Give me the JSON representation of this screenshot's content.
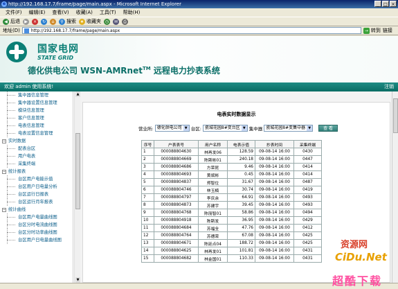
{
  "window": {
    "title": "http://192.168.17.7/frame/page/main.aspx - Microsoft Internet Explorer"
  },
  "menu": [
    "文件(F)",
    "编辑(E)",
    "查看(V)",
    "收藏(A)",
    "工具(T)",
    "帮助(H)"
  ],
  "toolbar": {
    "back": "后退",
    "search": "搜索",
    "favorites": "收藏夹"
  },
  "address": {
    "label": "地址(D)",
    "url": "http://192.168.17.7/frame/page/main.aspx",
    "go": "转到",
    "links": "链接"
  },
  "banner": {
    "brand_cn": "国家电网",
    "brand_en": "STATE GRID",
    "system_title": "德化供电公司 WSN-AMRnet",
    "tm": "TM",
    "system_suffix": " 远程电力抄表系统"
  },
  "userbar": {
    "welcome": "欢迎 admin 使用系统!",
    "logout": "注销"
  },
  "sidebar": {
    "items": [
      {
        "level": 1,
        "label": "集中器信息管理"
      },
      {
        "level": 1,
        "label": "集中器设置信息管理"
      },
      {
        "level": 1,
        "label": "模块信息管理"
      },
      {
        "level": 1,
        "label": "客户信息管理"
      },
      {
        "level": 1,
        "label": "电表信息管理"
      },
      {
        "level": 1,
        "label": "电表设置信息管理"
      },
      {
        "level": 0,
        "label": "实时数据"
      },
      {
        "level": 1,
        "label": "配表台区"
      },
      {
        "level": 1,
        "label": "用户电表"
      },
      {
        "level": 1,
        "label": "采集终端"
      },
      {
        "level": 0,
        "label": "统计报表"
      },
      {
        "level": 1,
        "label": "台区用户电能示值"
      },
      {
        "level": 1,
        "label": "台区用户日电量分析"
      },
      {
        "level": 1,
        "label": "台区运行日报表"
      },
      {
        "level": 1,
        "label": "台区运行月年报表"
      },
      {
        "level": 0,
        "label": "统计曲线"
      },
      {
        "level": 1,
        "label": "台区用户电量曲线图"
      },
      {
        "level": 1,
        "label": "台区分时电流曲线图"
      },
      {
        "level": 1,
        "label": "台区分时功率曲线图"
      },
      {
        "level": 1,
        "label": "台区用户日电量曲线图"
      }
    ]
  },
  "panel": {
    "title": "电表实时数据显示",
    "filter_label_1": "营业所:",
    "filter_value_1": "德化供电公司",
    "filter_label_2": "台区:",
    "filter_value_2": "瓷城花园8#变台区",
    "filter_label_3": "集中器",
    "filter_value_3": "瓷城花园8#变集中器",
    "query": "查 看"
  },
  "table": {
    "headers": [
      "序号",
      "户表表号",
      "用户名称",
      "电表示值",
      "抄表时间",
      "采集终端"
    ],
    "rows": [
      [
        "1",
        "000088804630",
        "林再发06",
        "128.59",
        "09-08-14 16:00",
        "0430"
      ],
      [
        "2",
        "000088804669",
        "陈斯彬01",
        "240.18",
        "09-08-14 16:00",
        "0447"
      ],
      [
        "3",
        "000088804686",
        "方荣昆",
        "9.46",
        "09-08-14 16:00",
        "0414"
      ],
      [
        "4",
        "000088804693",
        "黄斌彬",
        "0.45",
        "09-08-14 16:00",
        "0414"
      ],
      [
        "5",
        "000088804837",
        "郑智位",
        "31.67",
        "09-08-14 16:00",
        "0487"
      ],
      [
        "6",
        "000088804746",
        "林玉楠",
        "30.74",
        "09-08-14 16:00",
        "0419"
      ],
      [
        "7",
        "000088804797",
        "李庆余",
        "64.91",
        "09-08-14 16:00",
        "0493"
      ],
      [
        "8",
        "000088804873",
        "苏建宇",
        "39.45",
        "09-08-14 16:00",
        "0493"
      ],
      [
        "9",
        "000088804768",
        "陈丽智01",
        "58.86",
        "09-08-14 16:00",
        "0494"
      ],
      [
        "10",
        "000088804918",
        "陈斯发",
        "36.95",
        "09-08-14 16:00",
        "0429"
      ],
      [
        "11",
        "000088804684",
        "苏福全",
        "47.76",
        "09-08-14 16:00",
        "0412"
      ],
      [
        "12",
        "000088804764",
        "苏德荣",
        "67.08",
        "09-08-14 16:00",
        "0425"
      ],
      [
        "13",
        "000088804671",
        "陈廷点04",
        "188.72",
        "09-08-14 16:00",
        "0425"
      ],
      [
        "14",
        "000088804625",
        "林再发01",
        "101.81",
        "09-08-14 16:00",
        "0431"
      ],
      [
        "15",
        "000088804682",
        "林金国01",
        "110.33",
        "09-08-14 16:00",
        "0431"
      ]
    ]
  },
  "watermark": {
    "line1": "资源网",
    "line2": "CiDu.Net",
    "line3": "超酷下载"
  },
  "colors": {
    "brand": "#0b7f76",
    "title_bar": "#0a246a"
  }
}
